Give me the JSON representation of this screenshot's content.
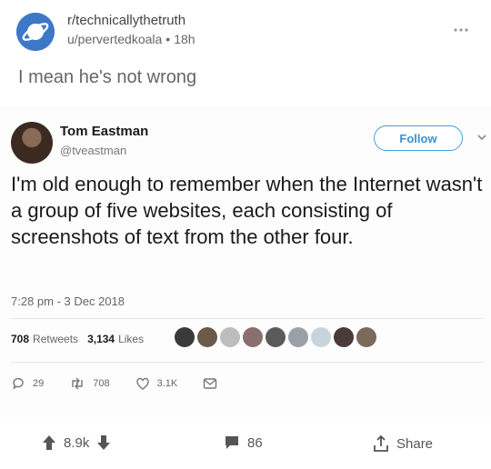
{
  "post": {
    "subreddit": "r/technicallythetruth",
    "author": "u/pervertedkoala",
    "separator": "•",
    "age": "18h",
    "title": "I mean he's not wrong",
    "icons": {
      "subreddit": "planet-icon",
      "menu": "kebab-menu-icon"
    }
  },
  "tweet": {
    "name": "Tom Eastman",
    "handle": "@tveastman",
    "follow_label": "Follow",
    "text": "I'm old enough to remember when the Internet wasn't a group of five websites, each consisting of screenshots of text from the other four.",
    "timestamp": "7:28 pm - 3 Dec 2018",
    "retweets_count": "708",
    "retweets_label": "Retweets",
    "likes_count": "3,134",
    "likes_label": "Likes",
    "actions": {
      "reply_count": "29",
      "retweet_count": "708",
      "like_count": "3.1K"
    },
    "colors": {
      "accent": "#3ea0e0"
    }
  },
  "footer": {
    "upvotes": "8.9k",
    "comments": "86",
    "share_label": "Share"
  }
}
